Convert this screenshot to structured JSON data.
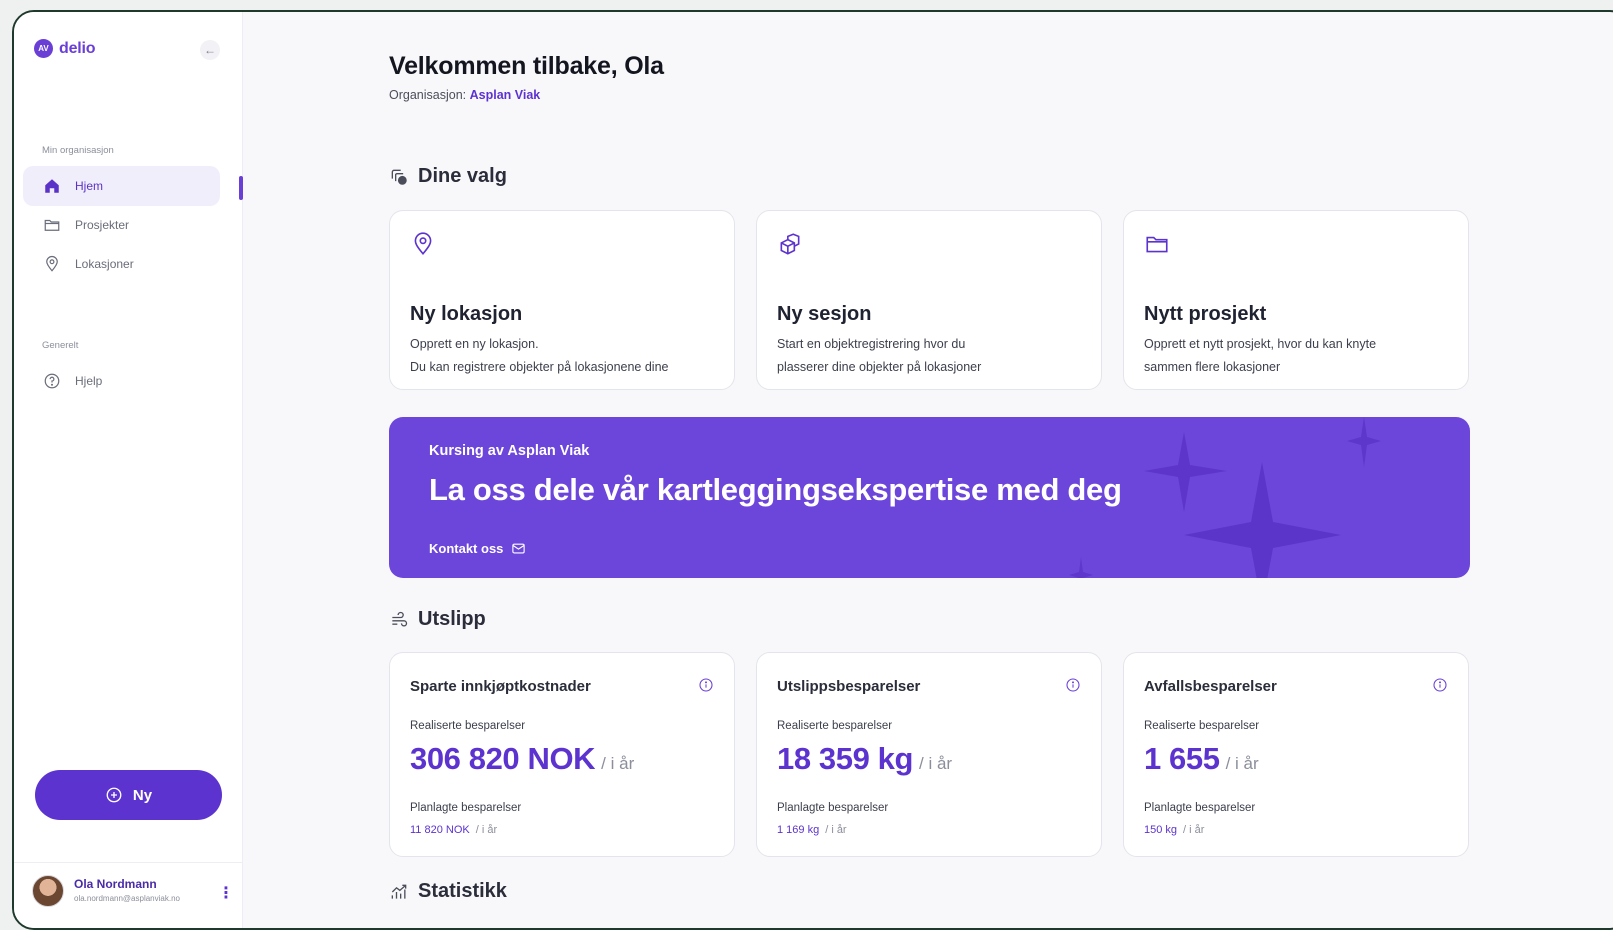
{
  "app": {
    "logo_mark": "AV",
    "name": "delio"
  },
  "sidebar": {
    "section_org": "Min organisasjon",
    "items": [
      {
        "label": "Hjem",
        "icon": "home-icon",
        "active": true
      },
      {
        "label": "Prosjekter",
        "icon": "folder-icon"
      },
      {
        "label": "Lokasjoner",
        "icon": "location-pin-icon"
      }
    ],
    "section_general": "Generelt",
    "help": {
      "label": "Hjelp",
      "icon": "help-circle-icon"
    },
    "new_button": "Ny",
    "user": {
      "name": "Ola Nordmann",
      "email": "ola.nordmann@asplanviak.no"
    }
  },
  "header": {
    "title": "Velkommen tilbake, Ola",
    "org_prefix": "Organisasjon:",
    "org_name": "Asplan Viak"
  },
  "choices": {
    "title": "Dine valg",
    "cards": [
      {
        "title": "Ny lokasjon",
        "icon": "location-pin-icon",
        "line1": "Opprett en ny lokasjon.",
        "line2": "Du kan registrere objekter på lokasjonene dine"
      },
      {
        "title": "Ny sesjon",
        "icon": "boxes-icon",
        "line1": "Start en objektregistrering hvor du",
        "line2": "plasserer dine objekter på lokasjoner"
      },
      {
        "title": "Nytt prosjekt",
        "icon": "folder-icon",
        "line1": "Opprett et nytt prosjekt, hvor du kan knyte",
        "line2": "sammen flere lokasjoner"
      }
    ]
  },
  "banner": {
    "subtitle": "Kursing av Asplan Viak",
    "title": "La oss dele vår kartleggingsekspertise med deg",
    "link": "Kontakt oss",
    "background": "#6c45db"
  },
  "emissions": {
    "title": "Utslipp",
    "cards": [
      {
        "title": "Sparte innkjøptkostnader",
        "realized_label": "Realiserte besparelser",
        "realized_value": "306 820 NOK",
        "period": "/ i år",
        "planned_label": "Planlagte besparelser",
        "planned_value": "11 820 NOK",
        "planned_period": "/ i år"
      },
      {
        "title": "Utslippsbesparelser",
        "realized_label": "Realiserte besparelser",
        "realized_value": "18 359 kg",
        "period": "/ i år",
        "planned_label": "Planlagte besparelser",
        "planned_value": "1 169 kg",
        "planned_period": "/ i år"
      },
      {
        "title": "Avfallsbesparelser",
        "realized_label": "Realiserte besparelser",
        "realized_value": "1 655",
        "period": "/ i år",
        "planned_label": "Planlagte besparelser",
        "planned_value": "150 kg",
        "planned_period": "/ i år"
      }
    ]
  },
  "statistics": {
    "title": "Statistikk"
  },
  "colors": {
    "accent": "#5c33cf",
    "frame": "#1f3a2c"
  }
}
